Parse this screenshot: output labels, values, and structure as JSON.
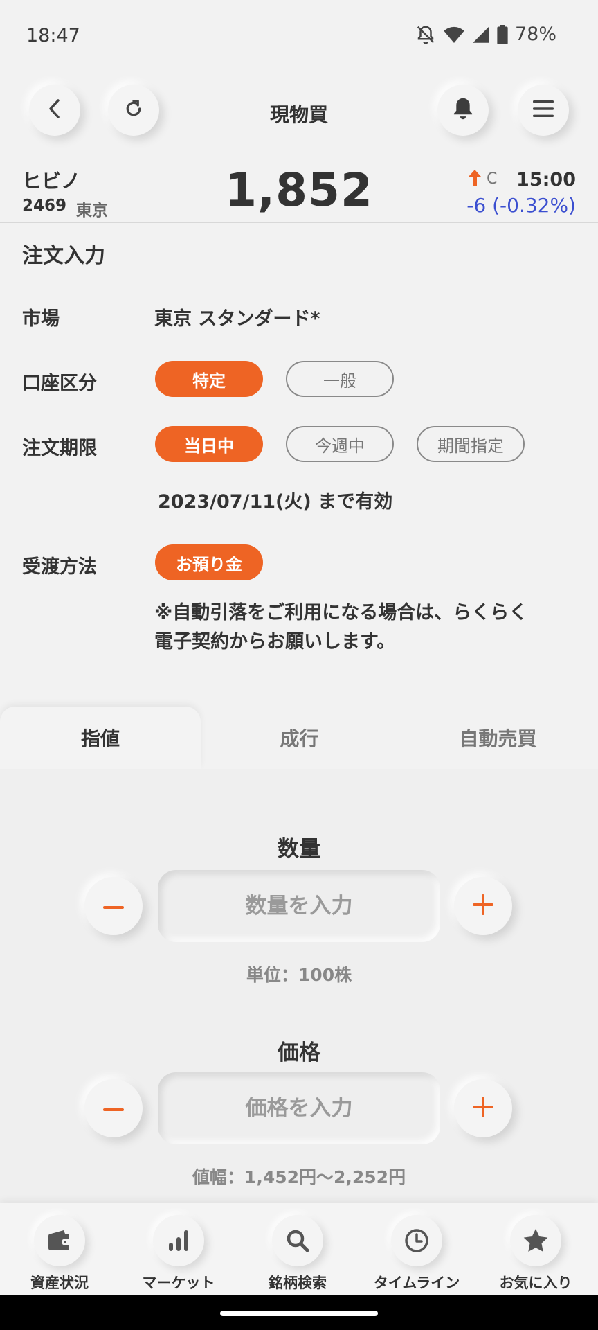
{
  "status_bar": {
    "time": "18:47",
    "battery": "78%"
  },
  "header": {
    "title": "現物買"
  },
  "stock": {
    "name": "ヒビノ",
    "code": "2469",
    "market": "東京",
    "price": "1,852",
    "flag": "C",
    "time": "15:00",
    "change": "-6 (-0.32%)"
  },
  "form": {
    "section_title": "注文入力",
    "market_label": "市場",
    "market_value": "東京 スタンダード*",
    "account_label": "口座区分",
    "account_options": [
      "特定",
      "一般"
    ],
    "account_selected": "特定",
    "period_label": "注文期限",
    "period_options": [
      "当日中",
      "今週中",
      "期間指定"
    ],
    "period_selected": "当日中",
    "valid_until": "2023/07/11(火) まで有効",
    "settlement_label": "受渡方法",
    "settlement_option": "お預り金",
    "notice_line1": "※自動引落をご利用になる場合は、らくらく",
    "notice_line2": "電子契約からお願いします。"
  },
  "order_tabs": [
    "指値",
    "成行",
    "自動売買"
  ],
  "order_tab_active": "指値",
  "quantity": {
    "title": "数量",
    "placeholder": "数量を入力",
    "value": "",
    "unit_hint": "単位：100株"
  },
  "price_field": {
    "title": "価格",
    "placeholder": "価格を入力",
    "value": "",
    "range_hint": "値幅：1,452円〜2,252円"
  },
  "bottom_nav": [
    {
      "label": "資産状況",
      "icon": "wallet-icon"
    },
    {
      "label": "マーケット",
      "icon": "bar-chart-icon"
    },
    {
      "label": "銘柄検索",
      "icon": "search-icon"
    },
    {
      "label": "タイムライン",
      "icon": "clock-icon"
    },
    {
      "label": "お気に入り",
      "icon": "star-icon"
    }
  ],
  "colors": {
    "accent": "#ee6424",
    "price_down": "#3b4fd0",
    "background": "#f2f2f2"
  }
}
